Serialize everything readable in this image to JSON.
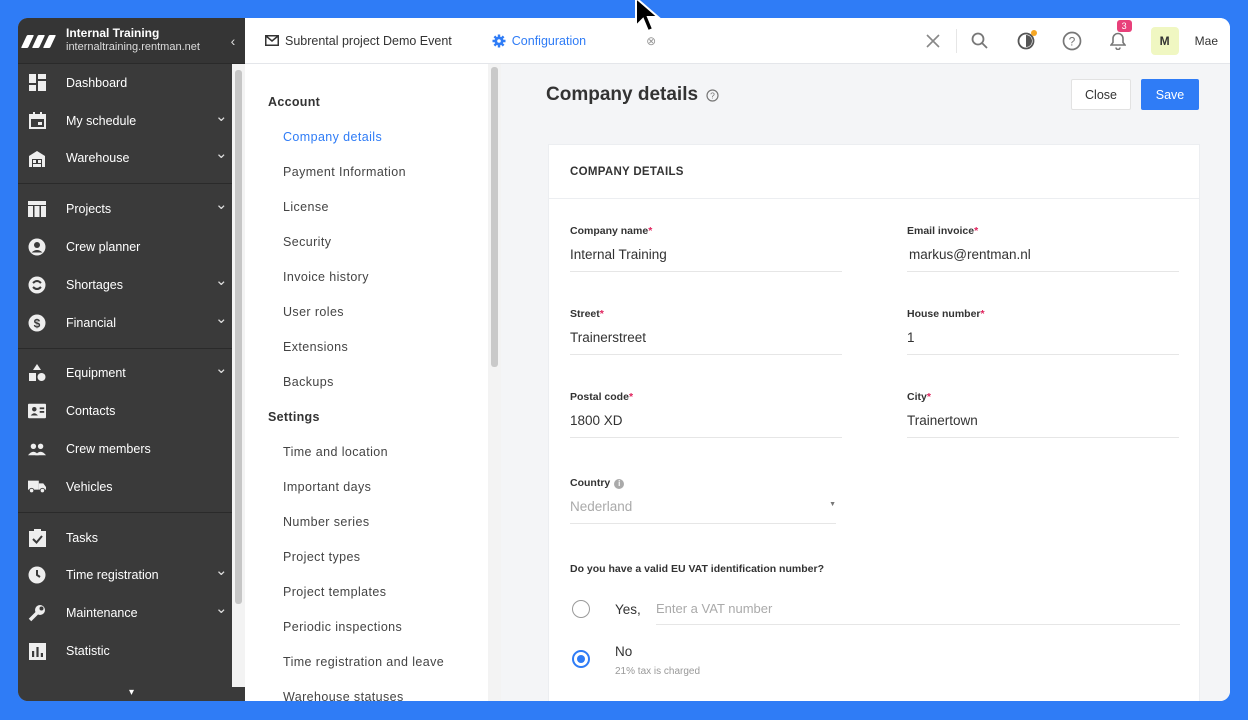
{
  "sidebar": {
    "org_name": "Internal Training",
    "org_url": "internaltraining.rentman.net",
    "collapse_glyph": "‹",
    "items": [
      {
        "label": "Dashboard",
        "icon": "dashboard-icon",
        "chevron": false
      },
      {
        "label": "My schedule",
        "icon": "calendar-icon",
        "chevron": true
      },
      {
        "label": "Warehouse",
        "icon": "warehouse-icon",
        "chevron": true
      },
      {
        "label": "Projects",
        "icon": "projects-icon",
        "chevron": true
      },
      {
        "label": "Crew planner",
        "icon": "crew-planner-icon",
        "chevron": false
      },
      {
        "label": "Shortages",
        "icon": "shortages-icon",
        "chevron": true
      },
      {
        "label": "Financial",
        "icon": "dollar-icon",
        "chevron": true
      },
      {
        "label": "Equipment",
        "icon": "equipment-icon",
        "chevron": true
      },
      {
        "label": "Contacts",
        "icon": "contacts-icon",
        "chevron": false
      },
      {
        "label": "Crew members",
        "icon": "crew-members-icon",
        "chevron": false
      },
      {
        "label": "Vehicles",
        "icon": "truck-icon",
        "chevron": false
      },
      {
        "label": "Tasks",
        "icon": "tasks-icon",
        "chevron": false
      },
      {
        "label": "Time registration",
        "icon": "clock-icon",
        "chevron": true
      },
      {
        "label": "Maintenance",
        "icon": "wrench-icon",
        "chevron": true
      },
      {
        "label": "Statistic",
        "icon": "statistic-icon",
        "chevron": false
      }
    ]
  },
  "topbar": {
    "tabs": [
      {
        "label": "Subrental project Demo Event",
        "icon": "mail-icon",
        "active": false
      },
      {
        "label": "Configuration",
        "icon": "gear-icon",
        "active": true
      }
    ],
    "notification_count": "3",
    "avatar_initial": "M",
    "user_name": "Mae"
  },
  "settings_nav": {
    "sections": [
      {
        "heading": "Account",
        "items": [
          "Company details",
          "Payment Information",
          "License",
          "Security",
          "Invoice history",
          "User roles",
          "Extensions",
          "Backups"
        ]
      },
      {
        "heading": "Settings",
        "items": [
          "Time and location",
          "Important days",
          "Number series",
          "Project types",
          "Project templates",
          "Periodic inspections",
          "Time registration and leave",
          "Warehouse statuses"
        ]
      }
    ],
    "active_item": "Company details"
  },
  "main": {
    "title": "Company details",
    "close_label": "Close",
    "save_label": "Save",
    "card_title": "COMPANY DETAILS",
    "fields": {
      "company_name": {
        "label": "Company name",
        "value": "Internal Training"
      },
      "email_invoice": {
        "label": "Email invoice",
        "value": "markus@rentman.nl"
      },
      "street": {
        "label": "Street",
        "value": "Trainerstreet"
      },
      "house_number": {
        "label": "House number",
        "value": "1"
      },
      "postal_code": {
        "label": "Postal code",
        "value": "1800 XD"
      },
      "city": {
        "label": "City",
        "value": "Trainertown"
      },
      "country": {
        "label": "Country",
        "value": "Nederland"
      }
    },
    "vat": {
      "question": "Do you have a valid EU VAT identification number?",
      "yes_label": "Yes,",
      "vat_placeholder": "Enter a VAT number",
      "no_label": "No",
      "no_hint": "21% tax is charged",
      "selected": "No"
    },
    "required_mark": "*"
  },
  "colors": {
    "accent": "#2f7cf6",
    "sidebar_bg": "#3a3a3a",
    "badge": "#e8407a",
    "required": "#e0245e",
    "page_bg": "#f4f5f7"
  }
}
